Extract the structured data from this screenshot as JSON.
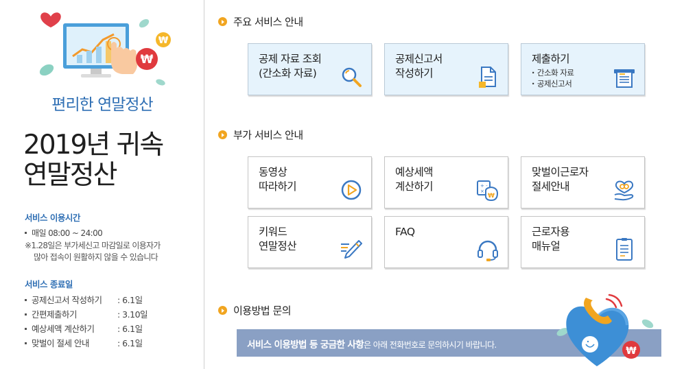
{
  "left": {
    "subtitle": "편리한 연말정산",
    "title": "2019년 귀속\n연말정산",
    "service_time": {
      "heading": "서비스 이용시간",
      "line": "매일 08:00 ~ 24:00",
      "note1": "※1.28일은 부가세신고 마감일로 이용자가",
      "note2": "많아 접속이 원활하지 않을 수 있습니다"
    },
    "service_end": {
      "heading": "서비스 종료일",
      "rows": [
        {
          "label": "공제신고서 작성하기",
          "date": ": 6.1일"
        },
        {
          "label": "간편제출하기",
          "date": ": 3.10일"
        },
        {
          "label": "예상세액 계산하기",
          "date": ": 6.1일"
        },
        {
          "label": "맞벌이 절세 안내",
          "date": ": 6.1일"
        }
      ]
    }
  },
  "main_services": {
    "title": "주요 서비스 안내",
    "cards": [
      {
        "label": "공제 자료 조회\n(간소화 자료)",
        "icon": "magnifier-icon"
      },
      {
        "label": "공제신고서\n작성하기",
        "icon": "document-icon"
      },
      {
        "label": "제출하기",
        "sub": [
          "간소화 자료",
          "공제신고서"
        ],
        "icon": "submit-tray-icon"
      }
    ]
  },
  "extra_services": {
    "title": "부가 서비스 안내",
    "cards": [
      {
        "label": "동영상\n따라하기",
        "icon": "play-icon"
      },
      {
        "label": "예상세액\n계산하기",
        "icon": "calculator-icon"
      },
      {
        "label": "맞벌이근로자\n절세안내",
        "icon": "rings-hand-icon"
      },
      {
        "label": "키워드\n연말정산",
        "icon": "pencil-icon"
      },
      {
        "label": "FAQ",
        "icon": "headset-icon"
      },
      {
        "label": "근로자용\n매뉴얼",
        "icon": "manual-icon"
      }
    ]
  },
  "inquiry": {
    "title": "이용방법 문의",
    "banner_bold": "서비스 이용방법 등 궁금한 사항",
    "banner_rest": "은 아래 전화번호로 문의하시기 바랍니다."
  },
  "colors": {
    "accent_blue": "#2f6fb4",
    "bullet_orange": "#f1a520",
    "banner": "#8aa0c4",
    "card_blue": "#e6f3fc"
  }
}
